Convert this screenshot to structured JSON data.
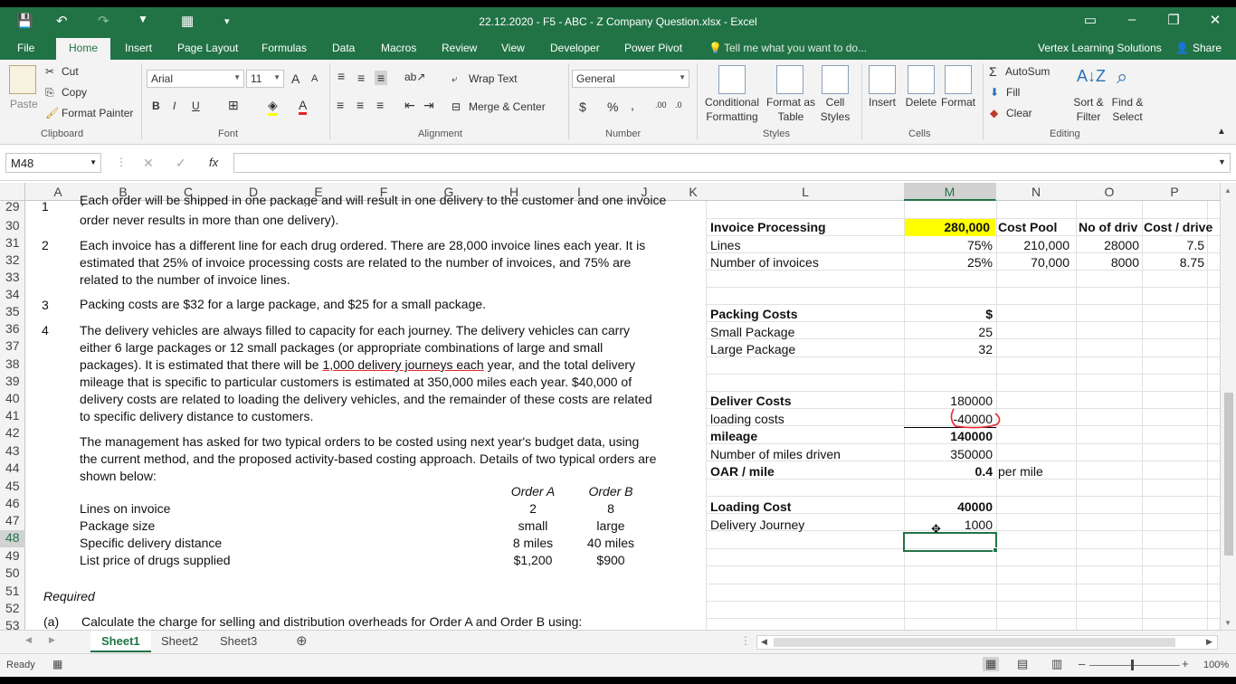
{
  "window": {
    "title": "22.12.2020 - F5 - ABC - Z Company Question.xlsx - Excel",
    "qat": {
      "save": "💾",
      "undo": "↶",
      "redo": "↷",
      "filter": "▼",
      "form": "▦",
      "more": "▾"
    }
  },
  "ribbon": {
    "file_tab": "File",
    "tabs": [
      "Home",
      "Insert",
      "Page Layout",
      "Formulas",
      "Data",
      "Macros",
      "Review",
      "View",
      "Developer",
      "Power Pivot"
    ],
    "tell_me": "Tell me what you want to do...",
    "account": "Vertex Learning Solutions",
    "share": "Share",
    "clipboard": {
      "paste": "Paste",
      "cut": "Cut",
      "copy": "Copy",
      "format_painter": "Format Painter",
      "group": "Clipboard"
    },
    "font": {
      "name": "Arial",
      "size": "11",
      "bold": "B",
      "italic": "I",
      "underline": "U",
      "group": "Font",
      "grow": "A",
      "shrink": "A"
    },
    "alignment": {
      "wrap_text": "Wrap Text",
      "merge_center": "Merge & Center",
      "group": "Alignment"
    },
    "number": {
      "format": "General",
      "currency": "$",
      "percent": "%",
      "comma": ",",
      "inc_dec": ".00",
      "dec_dec": ".0",
      "group": "Number"
    },
    "styles": {
      "conditional": "Conditional",
      "formatting": "Formatting",
      "format_as": "Format as",
      "table": "Table",
      "cell": "Cell",
      "styles": "Styles",
      "group": "Styles"
    },
    "cells": {
      "insert": "Insert",
      "delete": "Delete",
      "format": "Format",
      "group": "Cells"
    },
    "editing": {
      "autosum": "AutoSum",
      "fill": "Fill",
      "clear": "Clear",
      "sort": "Sort &",
      "filter": "Filter",
      "find": "Find &",
      "select": "Select",
      "group": "Editing"
    }
  },
  "formula_bar": {
    "name_box": "M48",
    "formula": "",
    "cancel": "✕",
    "enter": "✓",
    "fx": "fx"
  },
  "columns": [
    "A",
    "B",
    "C",
    "D",
    "E",
    "F",
    "G",
    "H",
    "I",
    "J",
    "K",
    "L",
    "M",
    "N",
    "O",
    "P"
  ],
  "rows": [
    "29",
    "30",
    "31",
    "32",
    "33",
    "34",
    "35",
    "36",
    "37",
    "38",
    "39",
    "40",
    "41",
    "42",
    "43",
    "44",
    "45",
    "46",
    "47",
    "48",
    "49",
    "50",
    "51",
    "52",
    "53"
  ],
  "selected_cell": {
    "column": "M",
    "row": "48"
  },
  "sheet": {
    "q_num_1": "1",
    "q1_text_top": "Each order will be shipped in one package and will result in one delivery to the customer and one invoice (an",
    "q1_text_2": "order never results in more than one delivery).",
    "q_num_2": "2",
    "q2_text": "Each invoice has a different line for each drug ordered. There are 28,000 invoice lines each year. It is estimated that 25% of invoice processing costs are related to the number of invoices, and 75% are related to the number of invoice lines.",
    "q_num_3": "3",
    "q3_text": "Packing costs are $32 for a large package, and $25 for a small package.",
    "q_num_4": "4",
    "q4_text_a": "The delivery vehicles are always filled to capacity for each journey. The delivery vehicles can carry either 6 large packages or 12 small packages (or appropriate combinations of large and small packages). It is estimated that there will be ",
    "q4_text_underlined": "1,000 delivery journeys each",
    "q4_text_b": " year, and the total delivery mileage that is specific to particular customers is estimated at 350,000 miles each year. $40,000 of delivery costs are related to loading the delivery vehicles, and the remainder of these costs are related to specific delivery distance to customers.",
    "mgmt_text": "The management has asked for two typical orders to be costed using next year's budget data, using the current method, and the proposed activity-based costing approach. Details of two typical orders are shown below:",
    "order_a": "Order A",
    "order_b": "Order B",
    "order_rows": [
      {
        "label": "Lines on invoice",
        "a": "2",
        "b": "8"
      },
      {
        "label": "Package size",
        "a": "small",
        "b": "large"
      },
      {
        "label": "Specific delivery distance",
        "a": "8 miles",
        "b": "40 miles"
      },
      {
        "label": "List price of drugs supplied",
        "a": "$1,200",
        "b": "$900"
      }
    ],
    "required": "Required",
    "part_a": "(a)",
    "part_a_text": "Calculate the charge for selling and distribution overheads for Order A and Order B using:",
    "invoice_processing": "Invoice Processing",
    "invoice_total": "280,000",
    "cost_pool_hdr": "Cost Pool",
    "no_of_drivers_hdr": "No of driv",
    "cost_per_driver_hdr": "Cost / drive",
    "lines_label": "Lines",
    "lines_pct": "75%",
    "lines_pool": "210,000",
    "lines_drivers": "28000",
    "lines_cost": "7.5",
    "invoices_label": "Number of invoices",
    "invoices_pct": "25%",
    "invoices_pool": "70,000",
    "invoices_drivers": "8000",
    "invoices_cost": "8.75",
    "packing_costs": "Packing Costs",
    "dollar_hdr": "$",
    "small_package": "Small Package",
    "small_value": "25",
    "large_package": "Large Package",
    "large_value": "32",
    "deliver_costs": "Deliver Costs",
    "deliver_value": "180000",
    "loading_costs": "loading costs",
    "loading_value": "-40000",
    "mileage": "mileage",
    "mileage_value": "140000",
    "miles_driven": "Number of miles driven",
    "miles_value": "350000",
    "oar_mile": "OAR / mile",
    "oar_value": "0.4",
    "per_mile": "per mile",
    "loading_cost": "Loading Cost",
    "loading_cost_value": "40000",
    "delivery_journey": "Delivery Journey",
    "journey_value": "1000"
  },
  "sheets": [
    "Sheet1",
    "Sheet2",
    "Sheet3"
  ],
  "status": {
    "ready": "Ready",
    "zoom": "100%"
  },
  "colors": {
    "excel_green": "#217346",
    "highlight_yellow": "#ffff00",
    "annotation_red": "#e8262b"
  }
}
